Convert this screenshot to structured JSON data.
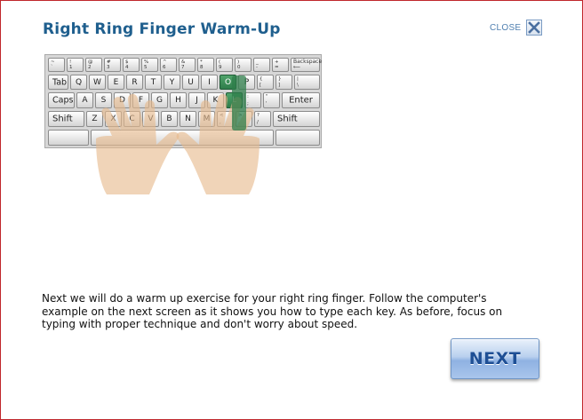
{
  "header": {
    "title": "Right Ring Finger Warm-Up",
    "close_label": "CLOSE"
  },
  "keyboard": {
    "row1": [
      {
        "top": "~",
        "bot": "`"
      },
      {
        "top": "!",
        "bot": "1"
      },
      {
        "top": "@",
        "bot": "2"
      },
      {
        "top": "#",
        "bot": "3"
      },
      {
        "top": "$",
        "bot": "4"
      },
      {
        "top": "%",
        "bot": "5"
      },
      {
        "top": "^",
        "bot": "6"
      },
      {
        "top": "&",
        "bot": "7"
      },
      {
        "top": "*",
        "bot": "8"
      },
      {
        "top": "(",
        "bot": "9"
      },
      {
        "top": ")",
        "bot": "0"
      },
      {
        "top": "_",
        "bot": "-"
      },
      {
        "top": "+",
        "bot": "="
      }
    ],
    "backspace": "Backspace",
    "tab": "Tab",
    "row2": [
      "Q",
      "W",
      "E",
      "R",
      "T",
      "Y",
      "U",
      "I",
      "O",
      "P"
    ],
    "row2_sym": [
      {
        "top": "{",
        "bot": "["
      },
      {
        "top": "}",
        "bot": "]"
      },
      {
        "top": "|",
        "bot": "\\"
      }
    ],
    "caps": "Caps",
    "row3": [
      "A",
      "S",
      "D",
      "F",
      "G",
      "H",
      "J",
      "K",
      "L"
    ],
    "row3_sym": [
      {
        "top": ":",
        "bot": ";"
      },
      {
        "top": "\"",
        "bot": "'"
      }
    ],
    "enter": "Enter",
    "shift_left": "Shift",
    "row4": [
      "Z",
      "X",
      "C",
      "V",
      "B",
      "N",
      "M"
    ],
    "row4_sym": [
      {
        "top": "<",
        "bot": ","
      },
      {
        "top": ">",
        "bot": "."
      },
      {
        "top": "?",
        "bot": "/"
      }
    ],
    "shift_right": "Shift",
    "highlighted_keys": [
      "O",
      "L"
    ]
  },
  "instructions": "Next we will do a warm up exercise for your right ring finger. Follow the computer's example on the next screen as it shows you how to type each key. As before, focus on typing with proper technique and don't worry about speed.",
  "next_button": {
    "label": "NEXT"
  },
  "colors": {
    "title": "#1f5f8e",
    "highlight": "#2f7d4b",
    "border": "#c0262c",
    "button_text": "#1e4f95"
  },
  "icons": {
    "close": "x-icon"
  }
}
